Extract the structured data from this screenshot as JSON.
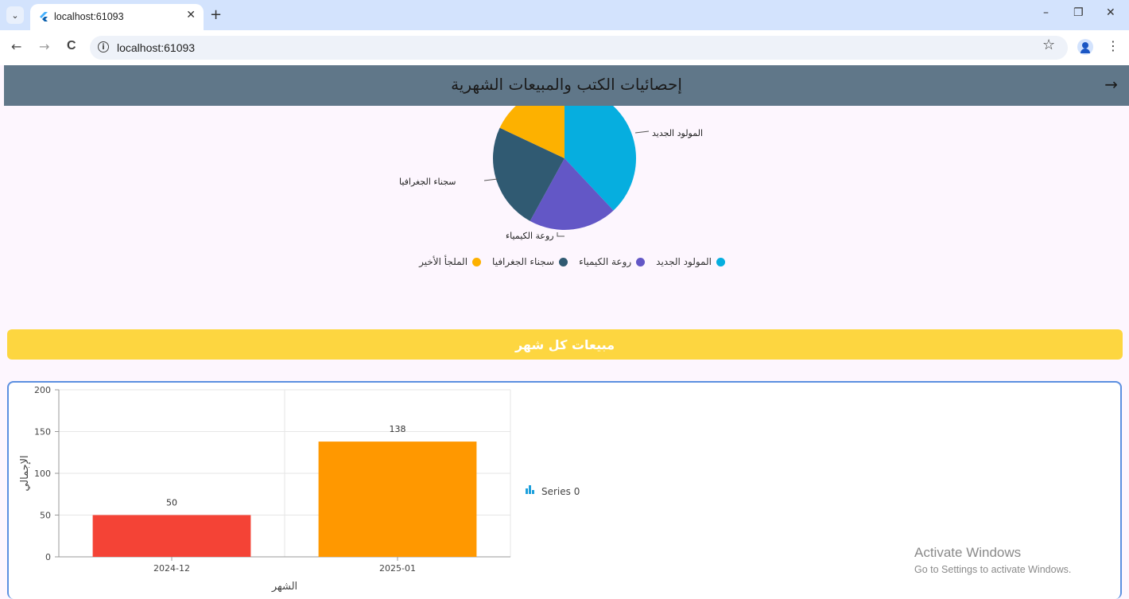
{
  "browser": {
    "tab_title": "localhost:61093",
    "url": "localhost:61093",
    "new_tab_glyph": "+",
    "close_glyph": "✕",
    "minimize_glyph": "–",
    "restore_glyph": "❐",
    "win_close_glyph": "✕",
    "back_glyph": "←",
    "forward_glyph": "→",
    "reload_glyph": "C",
    "star_glyph": "☆",
    "menu_glyph": "⋮",
    "tab_menu_glyph": "⌄"
  },
  "appbar": {
    "title": "إحصائيات الكتب والمبيعات الشهرية",
    "back_icon": "→"
  },
  "pie": {
    "slices": [
      {
        "name": "المولود الجديد",
        "value": 38,
        "color": "#06aedf"
      },
      {
        "name": "روعة الكيمياء",
        "value": 20,
        "color": "#6357c6"
      },
      {
        "name": "سجناء الجغرافيا",
        "value": 24,
        "color": "#305a72"
      },
      {
        "name": "الملجأ الأخير",
        "value": 18,
        "color": "#fdb100"
      }
    ]
  },
  "legend": [
    {
      "label": "المولود الجديد",
      "color": "#06aedf"
    },
    {
      "label": "روعة الكيمياء",
      "color": "#6357c6"
    },
    {
      "label": "سجناء الجغرافيا",
      "color": "#305a72"
    },
    {
      "label": "الملجأ الأخير",
      "color": "#fdb100"
    }
  ],
  "banner": {
    "title": "مبيعات كل شهر"
  },
  "chart_data": {
    "type": "bar",
    "categories": [
      "2024-12",
      "2025-01"
    ],
    "series": [
      {
        "name": "Series 0",
        "values": [
          50,
          138
        ],
        "colors": [
          "#f44336",
          "#ff9800"
        ]
      }
    ],
    "xlabel": "الشهر",
    "ylabel": "الإجمالي",
    "ylim": [
      0,
      200
    ],
    "yticks": [
      0,
      50,
      100,
      150,
      200
    ],
    "legend_placement": "right"
  },
  "watermark": {
    "line1": "Activate Windows",
    "line2": "Go to Settings to activate Windows."
  }
}
